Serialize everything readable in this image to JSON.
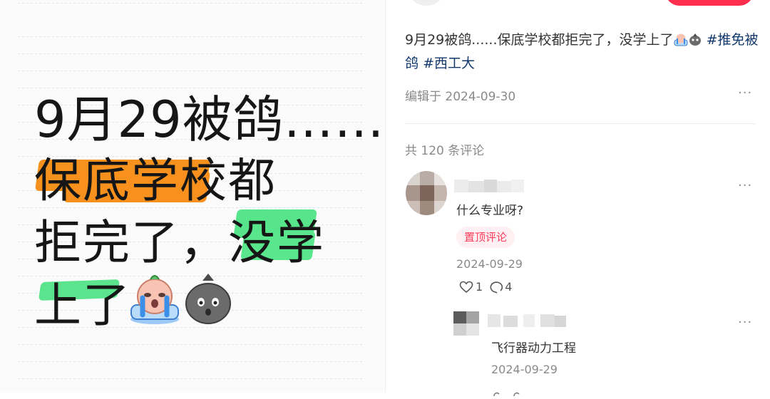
{
  "note": {
    "line1": "9月29被鸽……",
    "line2": "保底学校都",
    "line3": "拒完了，没学",
    "line4": "上了",
    "emoji_1": "crying-baby-emoji",
    "emoji_2": "trash-bag-emoji"
  },
  "post": {
    "text": "9月29被鸽......保底学校都拒完了，没学上了",
    "tags": [
      "#推免被鸽",
      "#西工大"
    ],
    "edit_date": "编辑于 2024-09-30",
    "more": "···"
  },
  "comments": {
    "count_label": "共 120 条评论",
    "items": [
      {
        "text": "什么专业呀?",
        "badge": "置顶评论",
        "date": "2024-09-29",
        "likes": "1",
        "replies": "4",
        "more": "···",
        "reply": {
          "text": "飞行器动力工程",
          "date": "2024-09-29",
          "more": "···"
        }
      }
    ]
  },
  "colors": {
    "accent": "#ff2e4d",
    "tag": "#13386c",
    "highlight_orange": "#f5921e",
    "highlight_green": "#56e58a"
  }
}
